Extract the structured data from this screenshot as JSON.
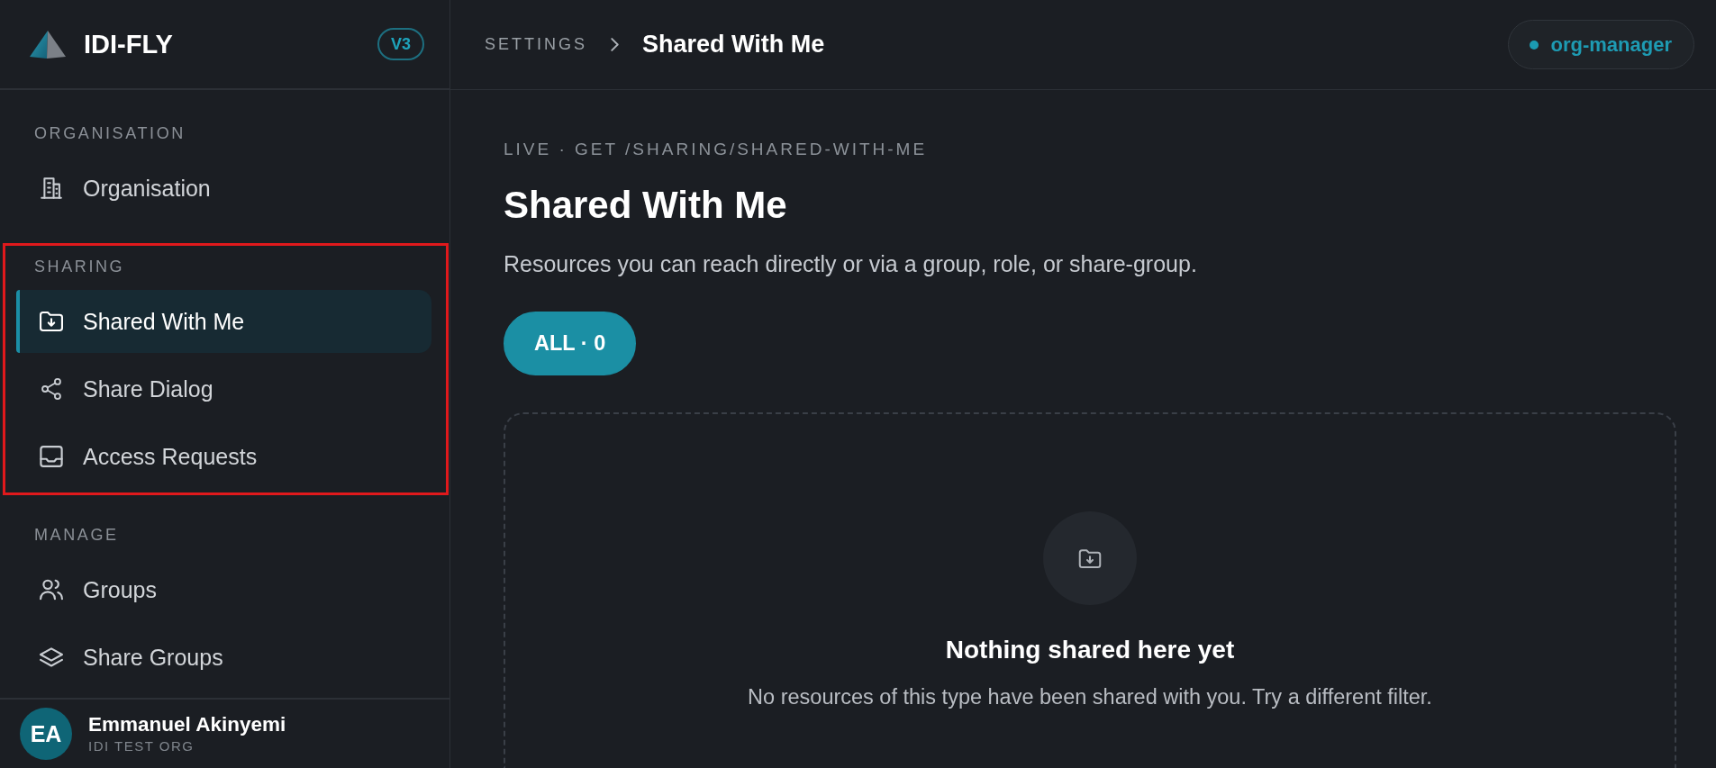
{
  "sidebar": {
    "brand": {
      "name": "IDI-FLY",
      "version": "V3"
    },
    "sections": [
      {
        "title": "ORGANISATION",
        "highlighted": false,
        "items": [
          {
            "label": "Organisation",
            "selected": false
          }
        ]
      },
      {
        "title": "SHARING",
        "highlighted": true,
        "items": [
          {
            "label": "Shared With Me",
            "selected": true
          },
          {
            "label": "Share Dialog",
            "selected": false
          },
          {
            "label": "Access Requests",
            "selected": false
          }
        ]
      },
      {
        "title": "MANAGE",
        "highlighted": false,
        "items": [
          {
            "label": "Groups",
            "selected": false
          },
          {
            "label": "Share Groups",
            "selected": false
          }
        ]
      }
    ],
    "user": {
      "initials": "EA",
      "name": "Emmanuel Akinyemi",
      "org": "IDI TEST ORG"
    }
  },
  "header": {
    "breadcrumb": [
      {
        "label": "SETTINGS",
        "current": false
      },
      {
        "label": "Shared With Me",
        "current": true
      }
    ],
    "role": {
      "label": "org-manager"
    }
  },
  "page": {
    "endpoint": "LIVE · GET /SHARING/SHARED-WITH-ME",
    "title": "Shared With Me",
    "description": "Resources you can reach directly or via a group, role, or share-group."
  },
  "filters": [
    {
      "label": "ALL · 0",
      "selected": true
    }
  ],
  "empty_state": {
    "title": "Nothing shared here yet",
    "message": "No resources of this type have been shared with you. Try a different filter."
  }
}
